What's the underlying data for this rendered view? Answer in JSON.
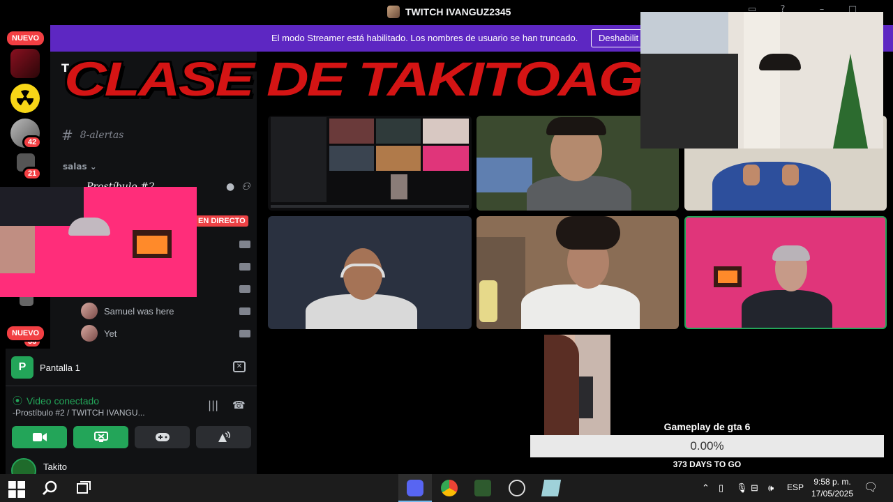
{
  "window": {
    "title": "TWITCH IVANGUZ2345"
  },
  "rail": {
    "nuevo_top": "NUEVO",
    "nuevo_bottom": "NUEVO",
    "badges": [
      "42",
      "21",
      "33"
    ]
  },
  "banner": {
    "message": "El modo Streamer está habilitado. Los nombres de usuario se han truncado.",
    "button": "Deshabilit"
  },
  "overlay": {
    "title": "CLASE DE TAKITOAGOGO"
  },
  "channels": {
    "top_letter": "T",
    "alerts_channel": "8-alertas",
    "category": "salas",
    "voice_channel": "Prostíbulo #2",
    "live_badge": "EN DIRECTO",
    "members": [
      "Samuel was here",
      "Yet"
    ]
  },
  "voice_panel": {
    "screen_icon": "P",
    "screen_label": "Pantalla 1",
    "status": "Video conectado",
    "channel_path": "-Prostíbulo #2 / TWITCH IVANGU...",
    "user": "Takito",
    "icons": [
      "camera-icon",
      "screen-share-icon",
      "gamepad-icon",
      "soundboard-icon"
    ]
  },
  "progress": {
    "label": "Gameplay de gta 6",
    "percent_text": "0.00%",
    "fraction": 0.0,
    "countdown": "373 DAYS TO GO"
  },
  "taskbar": {
    "lang": "ESP",
    "time": "9:58 p. m.",
    "date": "17/05/2025"
  },
  "colors": {
    "banner": "#5d27c2",
    "discord_green": "#23a559",
    "badge_red": "#f23f43",
    "title_red": "#d41414"
  }
}
